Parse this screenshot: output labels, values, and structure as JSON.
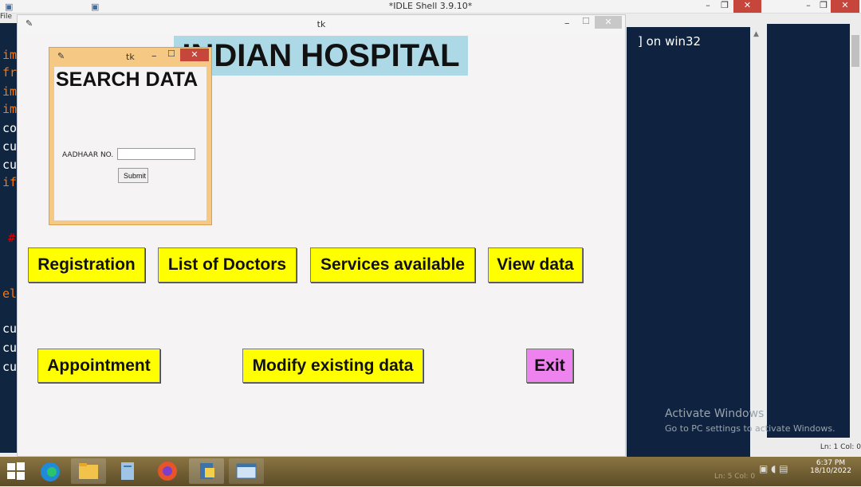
{
  "idle_shell": {
    "title": "*IDLE Shell 3.9.10*",
    "menu_file": "File",
    "minimize_icon": "minimize-icon",
    "maximize_icon": "maximize-icon",
    "close_icon": "close-icon",
    "min_symbol": "–",
    "max_symbol": "❐",
    "close_symbol": "✕",
    "code_fragments": [
      "im",
      "fr",
      "im",
      "im",
      "co",
      "cu",
      "cu",
      "if",
      "#",
      "el",
      "cu",
      "cu",
      "cu"
    ],
    "shell_text": "] on win32",
    "status": "Ln: 1   Col: 0",
    "colors": {
      "code_bg": "#10253f",
      "keyword": "#ff7700",
      "normal": "#ffffff"
    }
  },
  "activation_watermark": {
    "line1": "Activate Windows",
    "line2": "Go to PC settings to activate Windows."
  },
  "tk_main": {
    "window_title": "tk",
    "feather_icon": "tk-feather-icon",
    "feather_symbol": "✎",
    "min_symbol": "–",
    "max_symbol": "☐",
    "close_symbol": "✕",
    "heading": "INDIAN HOSPITAL",
    "heading_bg": "#add8e6",
    "buttons": {
      "registration": "Registration",
      "list_of_doctors": "List of Doctors",
      "services_available": "Services available",
      "view_data": "View data",
      "appointment": "Appointment",
      "modify_existing_data": "Modify existing data",
      "exit": "Exit"
    },
    "colors": {
      "button_bg": "#ffff00",
      "exit_bg": "#ee82ee",
      "window_bg": "#f5f3f4"
    }
  },
  "search_window": {
    "window_title": "tk",
    "feather_symbol": "✎",
    "min_symbol": "–",
    "max_symbol": "☐",
    "close_symbol": "✕",
    "heading": "SEARCH DATA",
    "aadhaar_label": "AADHAAR NO.",
    "aadhaar_value": "",
    "submit_label": "Submit",
    "frame_color": "#f5c883"
  },
  "taskbar": {
    "items": [
      "windows-start-icon",
      "edge-icon",
      "file-explorer-icon",
      "notepad-icon",
      "firefox-icon",
      "python-idle-icon",
      "tk-app-icon"
    ],
    "time": "6:37 PM",
    "date": "18/10/2022",
    "bg_status": "Ln: 5   Col: 0"
  }
}
